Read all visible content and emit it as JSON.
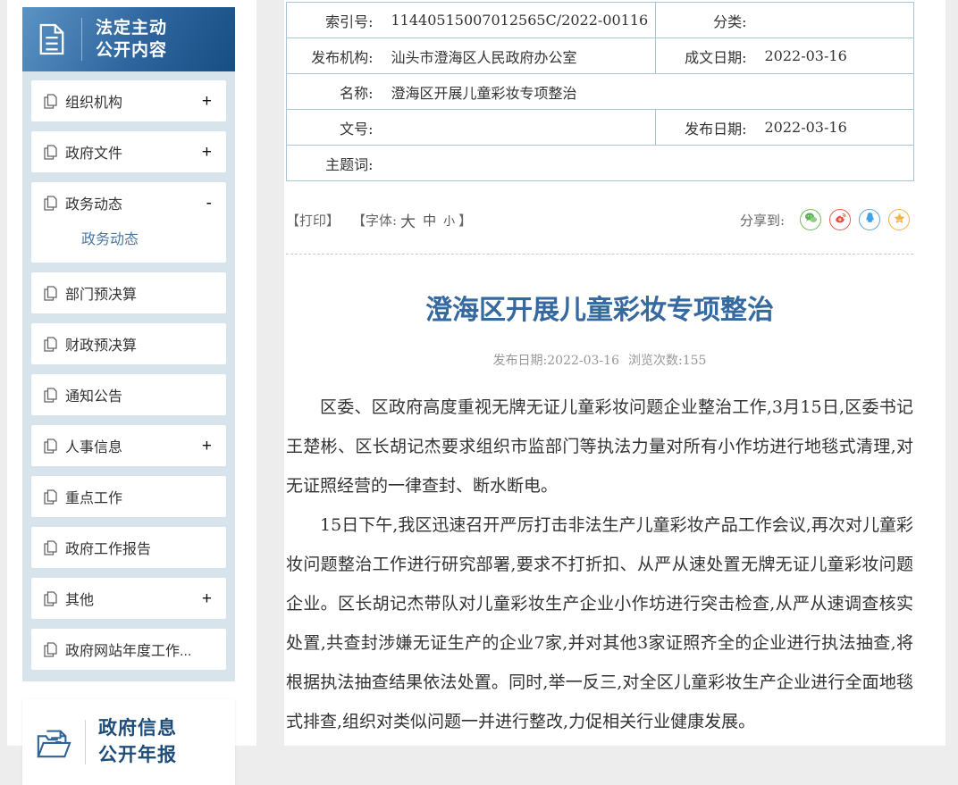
{
  "colors": {
    "page_bg": "#ededed",
    "sidebar_panel_bg": "#d8e4ec",
    "sidebar_header_gradient_start": "#5b93c4",
    "sidebar_header_gradient_end": "#174e82",
    "sub_link_blue": "#4878a8",
    "table_border": "#a9c5d8",
    "title_blue": "#35699f",
    "meta_gray": "#979797",
    "wechat_green": "#62b356",
    "weibo_red": "#e3503e",
    "qq_blue": "#41a3e3",
    "qzone_orange": "#f5b33b"
  },
  "sidebar": {
    "header": {
      "line1": "法定主动",
      "line2": "公开内容"
    },
    "items": [
      {
        "label": "组织机构",
        "toggle": "+"
      },
      {
        "label": "政府文件",
        "toggle": "+"
      },
      {
        "label": "政务动态",
        "toggle": "-",
        "active_child": "政务动态"
      },
      {
        "label": "部门预决算",
        "toggle": ""
      },
      {
        "label": "财政预决算",
        "toggle": ""
      },
      {
        "label": "通知公告",
        "toggle": ""
      },
      {
        "label": "人事信息",
        "toggle": "+"
      },
      {
        "label": "重点工作",
        "toggle": ""
      },
      {
        "label": "政府工作报告",
        "toggle": ""
      },
      {
        "label": "其他",
        "toggle": "+"
      },
      {
        "label": "政府网站年度工作...",
        "toggle": ""
      }
    ],
    "panel2": {
      "line1": "政府信息",
      "line2": "公开年报"
    }
  },
  "doc_meta": {
    "index_label": "索引号:",
    "index_value": "11440515007012565C/2022-00116",
    "category_label": "分类:",
    "category_value": "",
    "agency_label": "发布机构:",
    "agency_value": "汕头市澄海区人民政府办公室",
    "written_date_label": "成文日期:",
    "written_date_value": "2022-03-16",
    "name_label": "名称:",
    "name_value": "澄海区开展儿童彩妆专项整治",
    "doc_no_label": "文号:",
    "doc_no_value": "",
    "publish_date_label": "发布日期:",
    "publish_date_value": "2022-03-16",
    "keywords_label": "主题词:",
    "keywords_value": ""
  },
  "toolbar": {
    "print": "【打印】",
    "font_prefix": "【字体:",
    "font_large": "大",
    "font_medium": "中",
    "font_small": "小",
    "font_suffix": "】",
    "share_label": "分享到:",
    "share_icons": [
      "wechat",
      "weibo",
      "qq",
      "qzone"
    ]
  },
  "article": {
    "title": "澄海区开展儿童彩妆专项整治",
    "publish_date_label": "发布日期:",
    "publish_date": "2022-03-16",
    "views_label": "浏览次数:",
    "views": "155",
    "paragraphs": [
      "区委、区政府高度重视无牌无证儿童彩妆问题企业整治工作,3月15日,区委书记王楚彬、区长胡记杰要求组织市监部门等执法力量对所有小作坊进行地毯式清理,对无证照经营的一律查封、断水断电。",
      "15日下午,我区迅速召开严厉打击非法生产儿童彩妆产品工作会议,再次对儿童彩妆问题整治工作进行研究部署,要求不打折扣、从严从速处置无牌无证儿童彩妆问题企业。区长胡记杰带队对儿童彩妆生产企业小作坊进行突击检查,从严从速调查核实处置,共查封涉嫌无证生产的企业7家,并对其他3家证照齐全的企业进行执法抽查,将根据执法抽查结果依法处置。同时,举一反三,对全区儿童彩妆生产企业进行全面地毯式排查,组织对类似问题一并进行整改,力促相关行业健康发展。"
    ]
  }
}
